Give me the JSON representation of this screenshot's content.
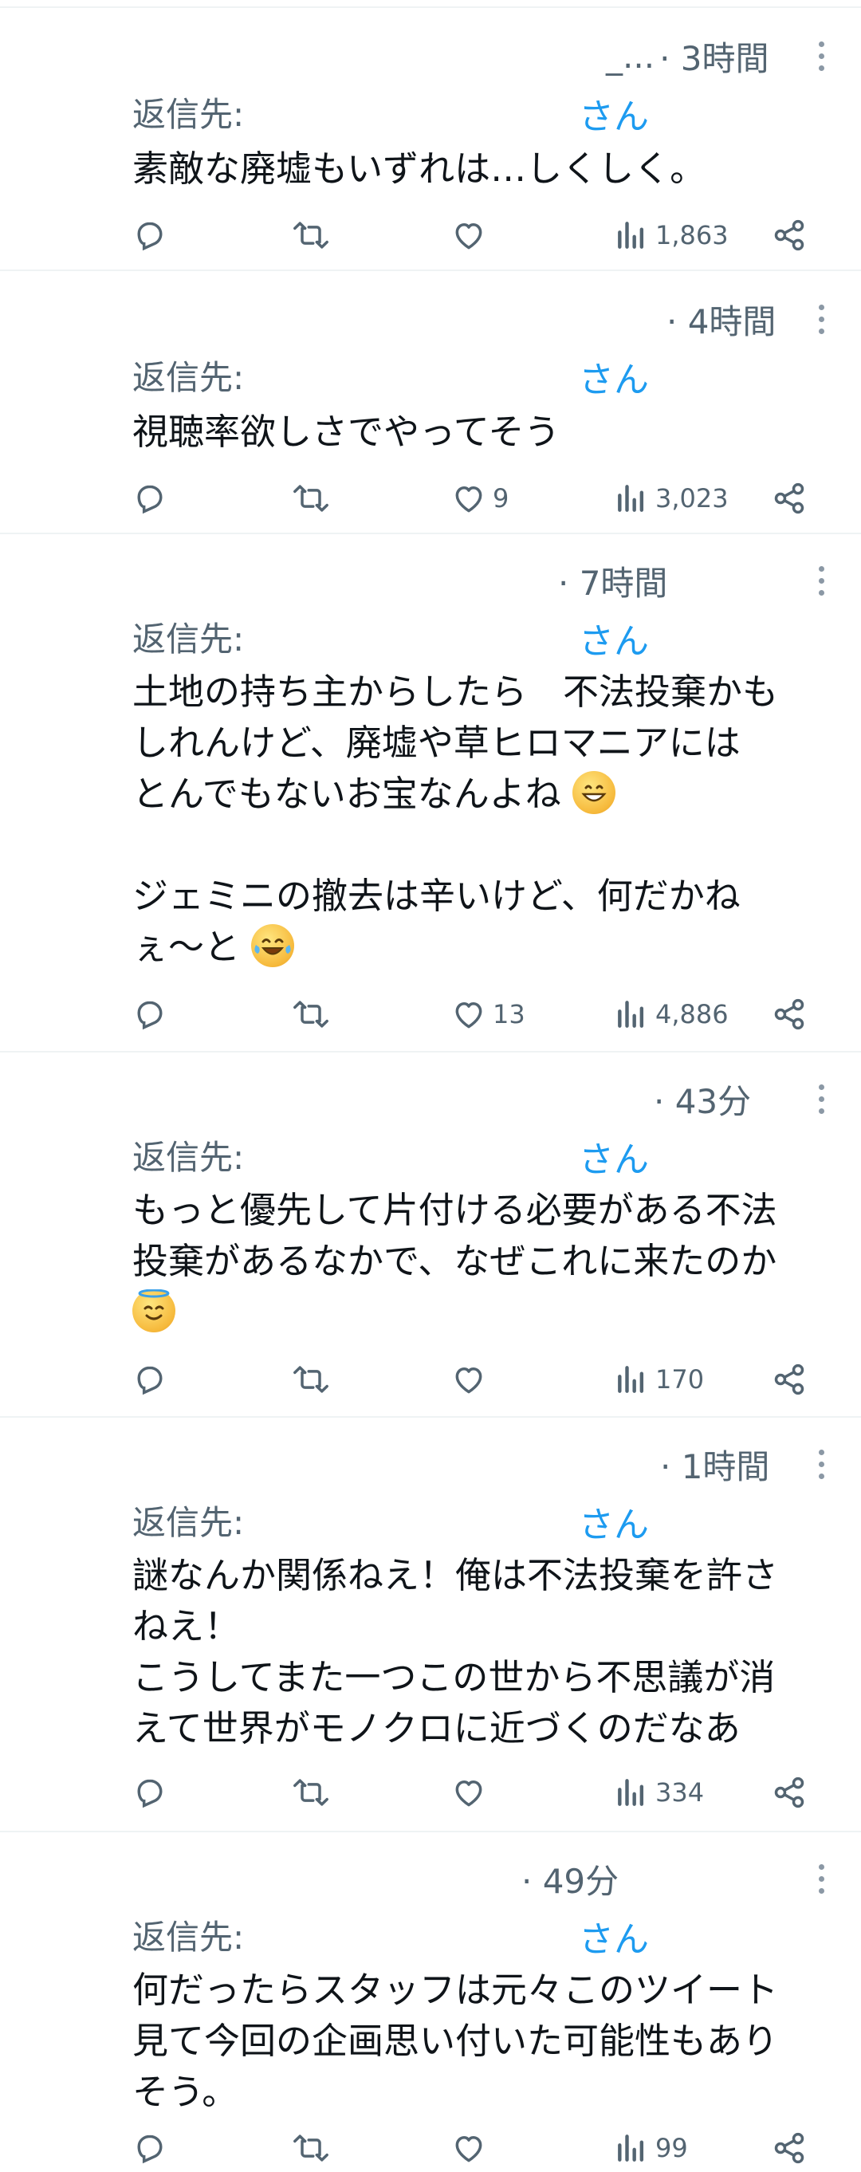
{
  "reply_prefix": "返信先:",
  "tweets": [
    {
      "handle_fragment": "_...",
      "time": "· 3時間",
      "reply_to": "さん",
      "lines": [
        "素敵な廃墟もいずれは…しくしく。"
      ],
      "likes": "",
      "views": "1,863"
    },
    {
      "handle_fragment": "",
      "time": "· 4時間",
      "reply_to": "さん",
      "lines": [
        "視聴率欲しさでやってそう"
      ],
      "likes": "9",
      "views": "3,023"
    },
    {
      "handle_fragment": "",
      "time": "· 7時間",
      "reply_to": "さん",
      "lines": [
        "土地の持ち主からしたら　不法投棄かも",
        "しれんけど、廃墟や草ヒロマニアには",
        "とんでもないお宝なんよね",
        "",
        "ジェミニの撤去は辛いけど、何だかね",
        "ぇ～と"
      ],
      "likes": "13",
      "views": "4,886"
    },
    {
      "handle_fragment": "",
      "time": "· 43分",
      "reply_to": "さん",
      "lines": [
        "もっと優先して片付ける必要がある不法",
        "投棄があるなかで、なぜこれに来たのか"
      ],
      "likes": "",
      "views": "170"
    },
    {
      "handle_fragment": "",
      "time": "· 1時間",
      "reply_to": "さん",
      "lines": [
        "謎なんか関係ねえ！俺は不法投棄を許さ",
        "ねえ！",
        "こうしてまた一つこの世から不思議が消",
        "えて世界がモノクロに近づくのだなあ"
      ],
      "likes": "",
      "views": "334"
    },
    {
      "handle_fragment": "",
      "time": "· 49分",
      "reply_to": "さん",
      "lines": [
        "何だったらスタッフは元々このツイート",
        "見て今回の企画思い付いた可能性もあり",
        "そう。"
      ],
      "likes": "",
      "views": "99"
    }
  ],
  "icons": {
    "reply": "reply-icon",
    "retweet": "retweet-icon",
    "like": "heart-icon",
    "views": "views-icon",
    "share": "share-icon",
    "more": "more-icon"
  },
  "colors": {
    "link": "#1d9bf0",
    "muted": "#536471",
    "text": "#0f1419",
    "divider": "#eff3f4"
  }
}
